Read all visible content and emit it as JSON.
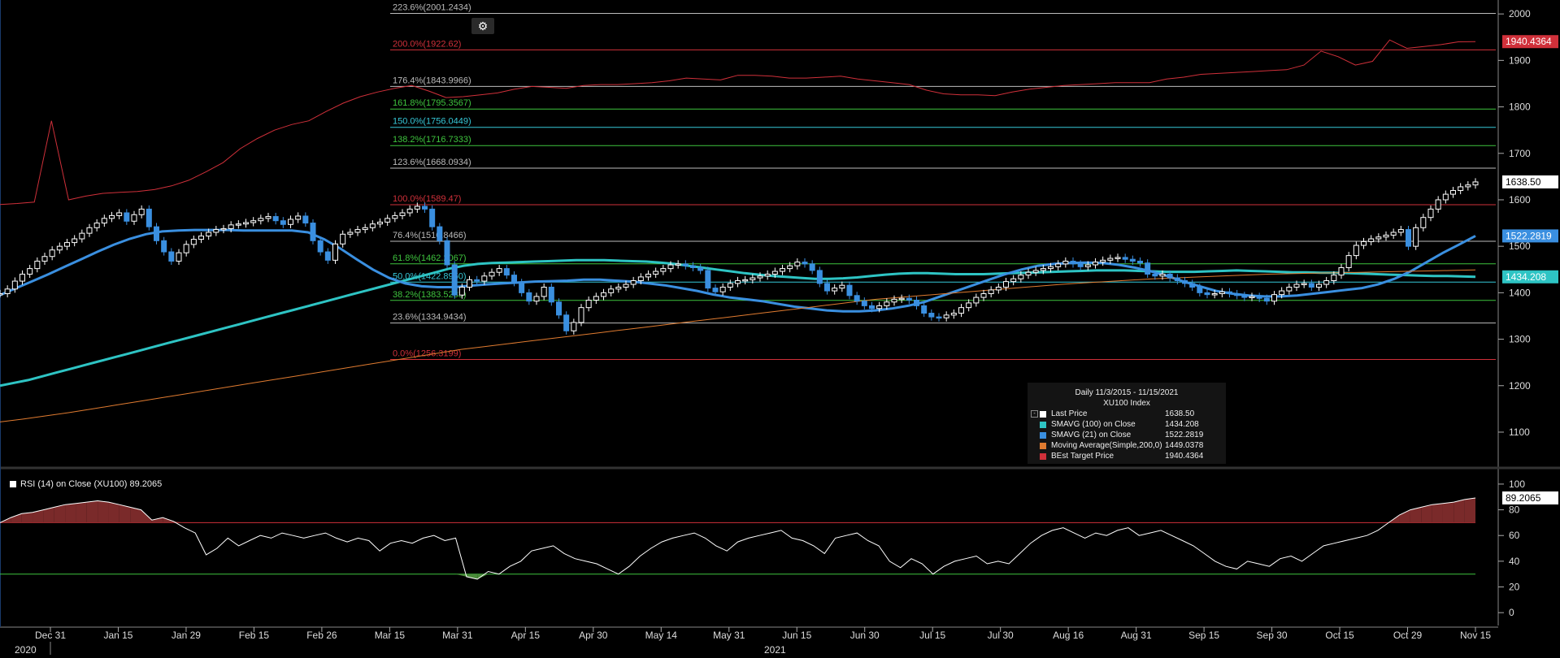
{
  "chart_data": [
    {
      "type": "candlestick",
      "title": "Daily 11/3/2015 - 11/15/2021",
      "subtitle": "XU100 Index",
      "ylim": [
        1030,
        2030
      ],
      "y_ticks": [
        "1100",
        "1200",
        "1300",
        "1400",
        "1500",
        "1600",
        "1700",
        "1800",
        "1900",
        "2000"
      ],
      "x_ticks": [
        "Dec 31",
        "Jan 15",
        "Jan 29",
        "Feb 15",
        "Feb 26",
        "Mar 15",
        "Mar 31",
        "Apr 15",
        "Apr 30",
        "May 14",
        "May 31",
        "Jun 15",
        "Jun 30",
        "Jul 15",
        "Jul 30",
        "Aug 16",
        "Aug 31",
        "Sep 15",
        "Sep 30",
        "Oct 15",
        "Oct 29",
        "Nov 15"
      ],
      "year_labels": [
        "2020",
        "2021"
      ],
      "fib_levels": [
        {
          "label": "0.0%(1256.3199)",
          "value": 1256.32,
          "color": "#d0303a"
        },
        {
          "label": "23.6%(1334.9434)",
          "value": 1334.94,
          "color": "#bbbbbb"
        },
        {
          "label": "38.2%(1383.5233)",
          "value": 1383.52,
          "color": "#3ec43e"
        },
        {
          "label": "50.0%(1422.8950)",
          "value": 1422.9,
          "color": "#36c8d8"
        },
        {
          "label": "61.8%(1462.2067)",
          "value": 1462.21,
          "color": "#3ec43e"
        },
        {
          "label": "76.4%(1510.8466)",
          "value": 1510.85,
          "color": "#bbbbbb"
        },
        {
          "label": "100.0%(1589.47)",
          "value": 1589.47,
          "color": "#d0303a"
        },
        {
          "label": "123.6%(1668.0934)",
          "value": 1668.09,
          "color": "#bbbbbb"
        },
        {
          "label": "138.2%(1716.7333)",
          "value": 1716.73,
          "color": "#3ec43e"
        },
        {
          "label": "150.0%(1756.0449)",
          "value": 1756.04,
          "color": "#36c8d8"
        },
        {
          "label": "161.8%(1795.3567)",
          "value": 1795.36,
          "color": "#3ec43e"
        },
        {
          "label": "176.4%(1843.9966)",
          "value": 1844.0,
          "color": "#bbbbbb"
        },
        {
          "label": "200.0%(1922.62)",
          "value": 1922.62,
          "color": "#d0303a"
        },
        {
          "label": "223.6%(2001.2434)",
          "value": 2001.24,
          "color": "#bbbbbb"
        }
      ],
      "series": [
        {
          "name": "Last Price",
          "color": "#ffffff",
          "last": "1638.50",
          "values": [
            1398,
            1408,
            1425,
            1440,
            1452,
            1468,
            1478,
            1492,
            1500,
            1508,
            1516,
            1528,
            1540,
            1550,
            1560,
            1566,
            1572,
            1554,
            1568,
            1580,
            1542,
            1512,
            1488,
            1468,
            1486,
            1504,
            1515,
            1522,
            1530,
            1536,
            1538,
            1546,
            1548,
            1551,
            1555,
            1560,
            1564,
            1555,
            1547,
            1558,
            1565,
            1550,
            1512,
            1488,
            1470,
            1505,
            1526,
            1530,
            1536,
            1540,
            1548,
            1552,
            1560,
            1566,
            1572,
            1580,
            1586,
            1580,
            1542,
            1512,
            1460,
            1395,
            1412,
            1428,
            1425,
            1436,
            1444,
            1452,
            1438,
            1422,
            1400,
            1382,
            1392,
            1412,
            1380,
            1352,
            1318,
            1336,
            1368,
            1384,
            1392,
            1400,
            1408,
            1412,
            1418,
            1426,
            1434,
            1440,
            1446,
            1452,
            1460,
            1462,
            1458,
            1454,
            1448,
            1410,
            1402,
            1412,
            1420,
            1426,
            1428,
            1432,
            1436,
            1440,
            1446,
            1452,
            1458,
            1466,
            1462,
            1448,
            1420,
            1404,
            1410,
            1416,
            1394,
            1382,
            1372,
            1366,
            1372,
            1380,
            1386,
            1388,
            1384,
            1372,
            1356,
            1348,
            1346,
            1352,
            1356,
            1368,
            1378,
            1390,
            1398,
            1406,
            1412,
            1424,
            1430,
            1438,
            1444,
            1448,
            1452,
            1456,
            1462,
            1468,
            1462,
            1456,
            1460,
            1466,
            1470,
            1474,
            1476,
            1472,
            1468,
            1464,
            1440,
            1436,
            1440,
            1432,
            1426,
            1420,
            1412,
            1400,
            1396,
            1398,
            1402,
            1398,
            1394,
            1390,
            1392,
            1388,
            1382,
            1396,
            1404,
            1412,
            1418,
            1420,
            1412,
            1418,
            1426,
            1438,
            1454,
            1480,
            1502,
            1510,
            1516,
            1520,
            1524,
            1530,
            1536,
            1500,
            1540,
            1562,
            1580,
            1600,
            1612,
            1620,
            1628,
            1632,
            1638.5
          ]
        },
        {
          "name": "SMAVG (100)  on Close",
          "color": "#2ec4c4",
          "last": "1434.208",
          "values": [
            1200,
            1206,
            1212,
            1220,
            1228,
            1236,
            1244,
            1252,
            1260,
            1268,
            1276,
            1284,
            1292,
            1300,
            1308,
            1316,
            1324,
            1332,
            1340,
            1348,
            1356,
            1364,
            1372,
            1380,
            1388,
            1396,
            1404,
            1412,
            1420,
            1428,
            1436,
            1444,
            1452,
            1458,
            1462,
            1464,
            1465,
            1466,
            1467,
            1468,
            1469,
            1470,
            1470,
            1470,
            1469,
            1468,
            1467,
            1465,
            1462,
            1458,
            1454,
            1450,
            1446,
            1442,
            1439,
            1436,
            1434,
            1432,
            1430,
            1430,
            1431,
            1433,
            1436,
            1439,
            1441,
            1442,
            1442,
            1441,
            1440,
            1440,
            1440,
            1441,
            1442,
            1443,
            1444,
            1445,
            1446,
            1447,
            1448,
            1448,
            1448,
            1447,
            1446,
            1445,
            1445,
            1445,
            1446,
            1447,
            1448,
            1447,
            1446,
            1445,
            1444,
            1444,
            1443,
            1443,
            1442,
            1441,
            1440,
            1439,
            1438,
            1437,
            1436,
            1436,
            1435,
            1434.2
          ]
        },
        {
          "name": "SMAVG (21)  on Close",
          "color": "#3a8fe0",
          "last": "1522.2819",
          "values": [
            1395,
            1410,
            1425,
            1440,
            1456,
            1472,
            1488,
            1503,
            1516,
            1526,
            1532,
            1534,
            1535,
            1535,
            1535,
            1534,
            1534,
            1534,
            1534,
            1530,
            1515,
            1495,
            1472,
            1450,
            1432,
            1420,
            1414,
            1412,
            1412,
            1415,
            1418,
            1420,
            1422,
            1424,
            1425,
            1426,
            1428,
            1428,
            1426,
            1424,
            1420,
            1416,
            1410,
            1404,
            1396,
            1390,
            1386,
            1382,
            1376,
            1370,
            1366,
            1362,
            1360,
            1360,
            1362,
            1366,
            1372,
            1380,
            1392,
            1404,
            1416,
            1428,
            1440,
            1450,
            1458,
            1462,
            1464,
            1465,
            1464,
            1460,
            1454,
            1446,
            1436,
            1424,
            1414,
            1404,
            1398,
            1394,
            1392,
            1392,
            1394,
            1398,
            1402,
            1406,
            1410,
            1418,
            1430,
            1446,
            1466,
            1486,
            1504,
            1522.3
          ]
        },
        {
          "name": "Moving Average(Simple,200,0)",
          "color": "#e07b30",
          "last": "1449.0378",
          "values": [
            1122,
            1128,
            1135,
            1142,
            1150,
            1158,
            1166,
            1174,
            1182,
            1190,
            1198,
            1206,
            1214,
            1222,
            1230,
            1238,
            1246,
            1254,
            1262,
            1270,
            1278,
            1284,
            1290,
            1296,
            1302,
            1308,
            1314,
            1320,
            1326,
            1332,
            1338,
            1344,
            1350,
            1356,
            1362,
            1368,
            1374,
            1380,
            1386,
            1390,
            1394,
            1398,
            1402,
            1406,
            1410,
            1414,
            1418,
            1421,
            1424,
            1427,
            1430,
            1432,
            1434,
            1436,
            1438,
            1440,
            1441,
            1442,
            1443,
            1444,
            1445,
            1446,
            1447,
            1448,
            1449.04
          ]
        },
        {
          "name": "BEst Target Price",
          "color": "#d0303a",
          "last": "1940.4364",
          "values": [
            1590,
            1592,
            1595,
            1770,
            1600,
            1608,
            1614,
            1616,
            1618,
            1622,
            1630,
            1642,
            1660,
            1680,
            1710,
            1732,
            1750,
            1762,
            1770,
            1790,
            1808,
            1822,
            1832,
            1840,
            1846,
            1834,
            1820,
            1822,
            1826,
            1830,
            1838,
            1844,
            1842,
            1840,
            1846,
            1848,
            1848,
            1850,
            1852,
            1856,
            1862,
            1860,
            1858,
            1868,
            1868,
            1866,
            1862,
            1862,
            1864,
            1866,
            1860,
            1856,
            1852,
            1848,
            1836,
            1828,
            1826,
            1826,
            1824,
            1832,
            1838,
            1842,
            1846,
            1848,
            1850,
            1852,
            1852,
            1852,
            1860,
            1864,
            1870,
            1872,
            1874,
            1876,
            1878,
            1880,
            1890,
            1920,
            1908,
            1890,
            1898,
            1944,
            1926,
            1930,
            1934,
            1940,
            1940.44
          ]
        }
      ]
    },
    {
      "type": "line",
      "title": "RSI (14)  on Close (XU100) 89.2065",
      "ylim": [
        -10,
        105
      ],
      "y_ticks": [
        "0",
        "20",
        "40",
        "60",
        "80",
        "100"
      ],
      "upper_band": 70,
      "lower_band": 30,
      "series": [
        {
          "name": "RSI (14)  on Close (XU100)",
          "color": "#ffffff",
          "last": "89.2065",
          "values": [
            70,
            74,
            77,
            78,
            80,
            82,
            84,
            85,
            86,
            87,
            86,
            84,
            82,
            80,
            72,
            74,
            71,
            66,
            62,
            45,
            50,
            58,
            52,
            56,
            60,
            58,
            62,
            60,
            58,
            60,
            62,
            58,
            55,
            58,
            56,
            48,
            54,
            56,
            54,
            58,
            60,
            56,
            58,
            28,
            26,
            32,
            30,
            36,
            40,
            48,
            50,
            52,
            46,
            42,
            40,
            38,
            34,
            30,
            36,
            44,
            50,
            55,
            58,
            60,
            62,
            58,
            52,
            48,
            55,
            58,
            60,
            62,
            64,
            58,
            56,
            52,
            46,
            58,
            60,
            62,
            56,
            52,
            40,
            35,
            42,
            38,
            30,
            36,
            40,
            42,
            44,
            38,
            40,
            38,
            46,
            54,
            60,
            64,
            66,
            62,
            58,
            62,
            60,
            64,
            66,
            60,
            62,
            64,
            60,
            56,
            52,
            46,
            40,
            36,
            34,
            40,
            38,
            36,
            42,
            44,
            40,
            46,
            52,
            54,
            56,
            58,
            60,
            64,
            70,
            76,
            80,
            82,
            84,
            85,
            86,
            88,
            89.2
          ]
        }
      ]
    }
  ],
  "legend": {
    "title": "Daily 11/3/2015 - 11/15/2021",
    "subtitle": "XU100 Index",
    "items": [
      {
        "name": "Last Price",
        "value": "1638.50",
        "color": "#ffffff"
      },
      {
        "name": "SMAVG (100)  on Close",
        "value": "1434.208",
        "color": "#2ec4c4"
      },
      {
        "name": "SMAVG (21)  on Close",
        "value": "1522.2819",
        "color": "#3a8fe0"
      },
      {
        "name": "Moving Average(Simple,200,0)",
        "value": "1449.0378",
        "color": "#e07b30"
      },
      {
        "name": "BEst Target Price",
        "value": "1940.4364",
        "color": "#d0303a"
      }
    ]
  },
  "rsi_label": "RSI (14)  on Close (XU100) 89.2065",
  "right_badges": [
    {
      "text": "1940.4364",
      "bg": "#d0303a",
      "value": 1940.44,
      "panel": "price"
    },
    {
      "text": "1638.50",
      "bg": "#ffffff",
      "value": 1638.5,
      "panel": "price"
    },
    {
      "text": "1522.2819",
      "bg": "#3a8fe0",
      "value": 1522.28,
      "panel": "price"
    },
    {
      "text": "1434.208",
      "bg": "#2ec4c4",
      "value": 1434.21,
      "panel": "price"
    },
    {
      "text": "89.2065",
      "bg": "#ffffff",
      "value": 89.21,
      "panel": "rsi"
    }
  ],
  "gear_icon": "gear-icon"
}
